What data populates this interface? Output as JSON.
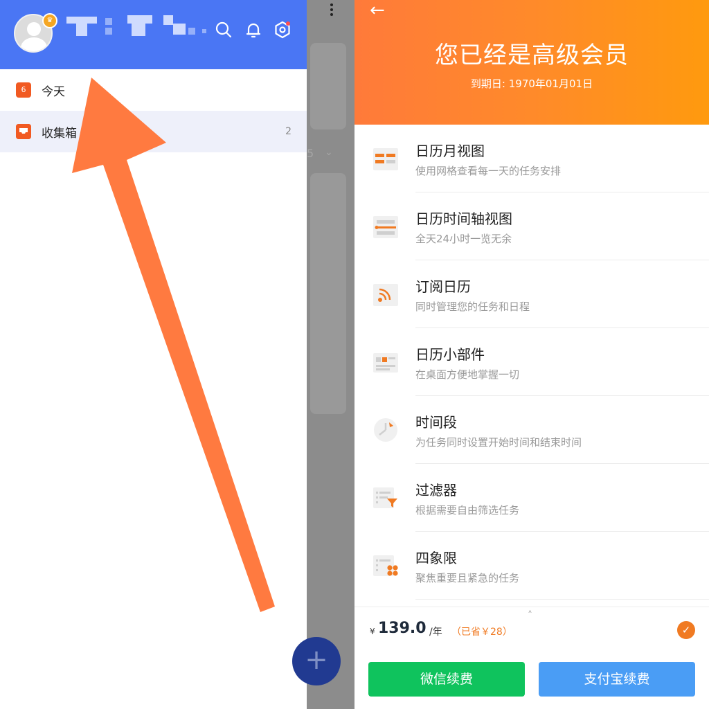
{
  "drawer": {
    "items": [
      {
        "label": "今天",
        "icon": "calendar-icon",
        "badge": "6",
        "count": ""
      },
      {
        "label": "收集箱",
        "icon": "inbox-icon",
        "count": "2"
      }
    ]
  },
  "scrim": {
    "fab_label": "+",
    "ghost_text": "5"
  },
  "premium": {
    "back_icon": "←",
    "title": "您已经是高级会员",
    "expiry": "到期日: 1970年01月01日",
    "features": [
      {
        "name": "日历月视图",
        "desc": "使用网格查看每一天的任务安排",
        "icon": "month-view-icon"
      },
      {
        "name": "日历时间轴视图",
        "desc": "全天24小时一览无余",
        "icon": "timeline-view-icon"
      },
      {
        "name": "订阅日历",
        "desc": "同时管理您的任务和日程",
        "icon": "rss-icon"
      },
      {
        "name": "日历小部件",
        "desc": "在桌面方便地掌握一切",
        "icon": "widget-icon"
      },
      {
        "name": "时间段",
        "desc": "为任务同时设置开始时间和结束时间",
        "icon": "clock-icon"
      },
      {
        "name": "过滤器",
        "desc": "根据需要自由筛选任务",
        "icon": "filter-icon"
      },
      {
        "name": "四象限",
        "desc": "聚焦重要且紧急的任务",
        "icon": "quadrant-icon"
      }
    ],
    "price": {
      "currency": "¥",
      "amount": "139.0",
      "period": "/年",
      "saved": "（已省￥28）"
    },
    "buttons": {
      "wechat": "微信续费",
      "alipay": "支付宝续费"
    }
  },
  "colors": {
    "header_blue": "#4a76f4",
    "accent_orange": "#f07a22",
    "wechat_green": "#0fc35d",
    "alipay_blue": "#4a9df5",
    "arrow": "#ff7a40"
  }
}
